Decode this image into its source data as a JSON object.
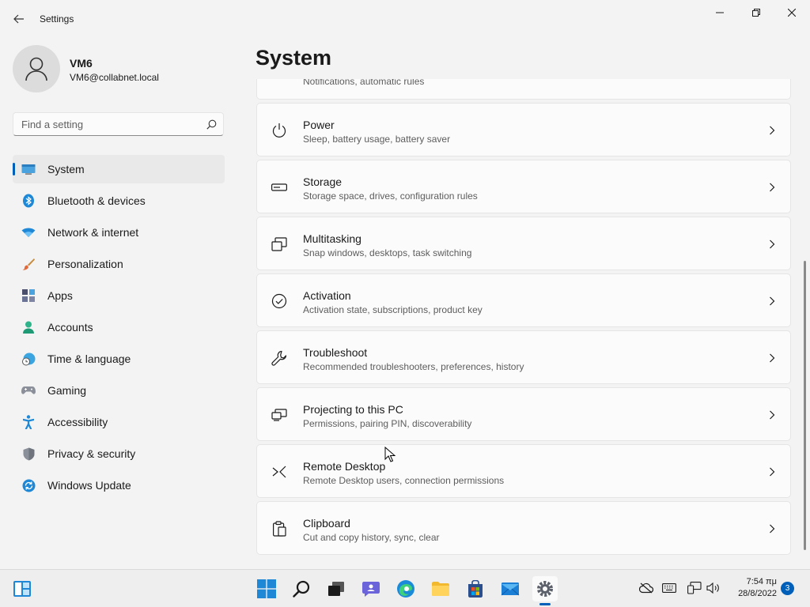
{
  "window": {
    "title": "Settings"
  },
  "profile": {
    "name": "VM6",
    "email": "VM6@collabnet.local"
  },
  "search": {
    "placeholder": "Find a setting"
  },
  "nav": {
    "items": [
      {
        "label": "System",
        "icon": "monitor-icon",
        "active": true
      },
      {
        "label": "Bluetooth & devices",
        "icon": "bluetooth-icon"
      },
      {
        "label": "Network & internet",
        "icon": "wifi-icon"
      },
      {
        "label": "Personalization",
        "icon": "brush-icon"
      },
      {
        "label": "Apps",
        "icon": "apps-icon"
      },
      {
        "label": "Accounts",
        "icon": "person-icon"
      },
      {
        "label": "Time & language",
        "icon": "globe-clock-icon"
      },
      {
        "label": "Gaming",
        "icon": "controller-icon"
      },
      {
        "label": "Accessibility",
        "icon": "accessibility-icon"
      },
      {
        "label": "Privacy & security",
        "icon": "shield-icon"
      },
      {
        "label": "Windows Update",
        "icon": "update-icon"
      }
    ]
  },
  "page": {
    "title": "System"
  },
  "cards": [
    {
      "title": "",
      "desc": "Notifications, automatic rules",
      "icon": ""
    },
    {
      "title": "Power",
      "desc": "Sleep, battery usage, battery saver",
      "icon": "power-icon"
    },
    {
      "title": "Storage",
      "desc": "Storage space, drives, configuration rules",
      "icon": "storage-icon"
    },
    {
      "title": "Multitasking",
      "desc": "Snap windows, desktops, task switching",
      "icon": "multitasking-icon"
    },
    {
      "title": "Activation",
      "desc": "Activation state, subscriptions, product key",
      "icon": "check-circle-icon"
    },
    {
      "title": "Troubleshoot",
      "desc": "Recommended troubleshooters, preferences, history",
      "icon": "wrench-icon"
    },
    {
      "title": "Projecting to this PC",
      "desc": "Permissions, pairing PIN, discoverability",
      "icon": "projecting-icon"
    },
    {
      "title": "Remote Desktop",
      "desc": "Remote Desktop users, connection permissions",
      "icon": "remote-desktop-icon"
    },
    {
      "title": "Clipboard",
      "desc": "Cut and copy history, sync, clear",
      "icon": "clipboard-icon"
    }
  ],
  "taskbar": {
    "apps": [
      "start-icon",
      "search-icon",
      "task-view-icon",
      "chat-icon",
      "edge-icon",
      "file-explorer-icon",
      "store-icon",
      "mail-icon",
      "settings-icon"
    ],
    "tray": [
      "cloud-off-icon",
      "keyboard-icon",
      "network-icon",
      "volume-icon"
    ],
    "time": "7:54 πμ",
    "date": "28/8/2022",
    "notifications": "3"
  },
  "colors": {
    "accent": "#005fb8",
    "background": "#f3f3f3",
    "card": "#fbfbfb"
  }
}
